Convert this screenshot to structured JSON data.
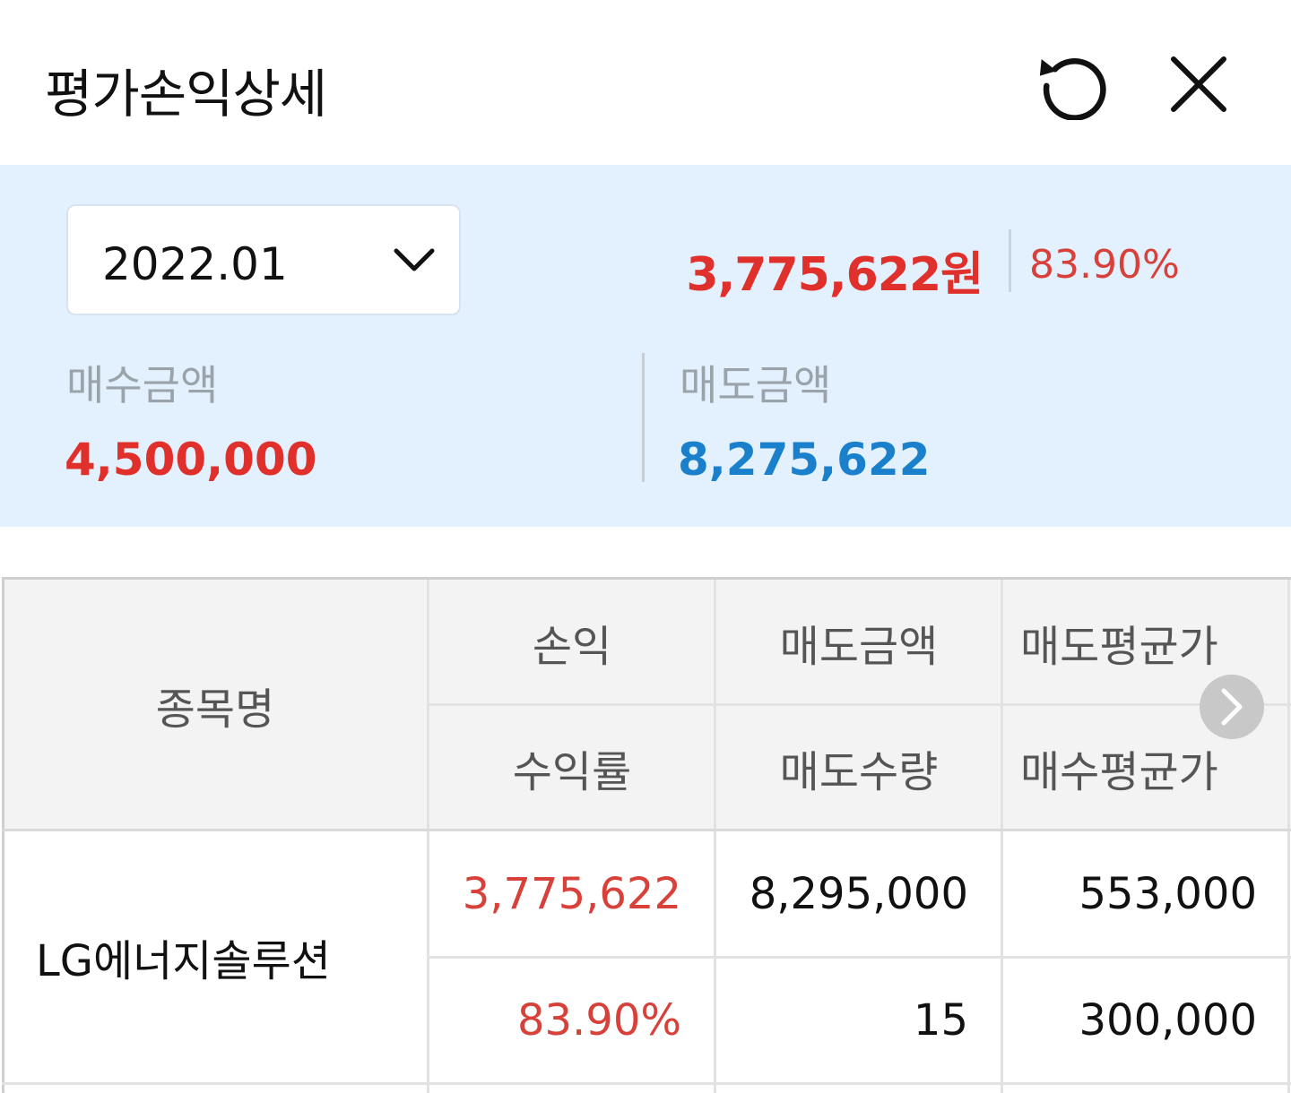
{
  "header": {
    "title": "평가손익상세"
  },
  "summary": {
    "month": "2022.01",
    "total_profit": "3,775,622원",
    "total_rate": "83.90%",
    "buy_label": "매수금액",
    "buy_amount": "4,500,000",
    "sell_label": "매도금액",
    "sell_amount": "8,275,622"
  },
  "table": {
    "headers": {
      "name": "종목명",
      "profit": "손익",
      "sell_amount": "매도금액",
      "sell_avg_price": "매도평균가",
      "rate": "수익률",
      "sell_qty": "매도수량",
      "buy_avg_price": "매수평균가"
    },
    "rows": [
      {
        "name": "LG에너지솔루션",
        "profit": "3,775,622",
        "sell_amount": "8,295,000",
        "sell_avg_price": "553,000",
        "rate": "83.90%",
        "sell_qty": "15",
        "buy_avg_price": "300,000"
      }
    ]
  },
  "colors": {
    "positive": "#e0302c",
    "sell_blue": "#1a80cc",
    "summary_bg": "#e3f0fd"
  }
}
